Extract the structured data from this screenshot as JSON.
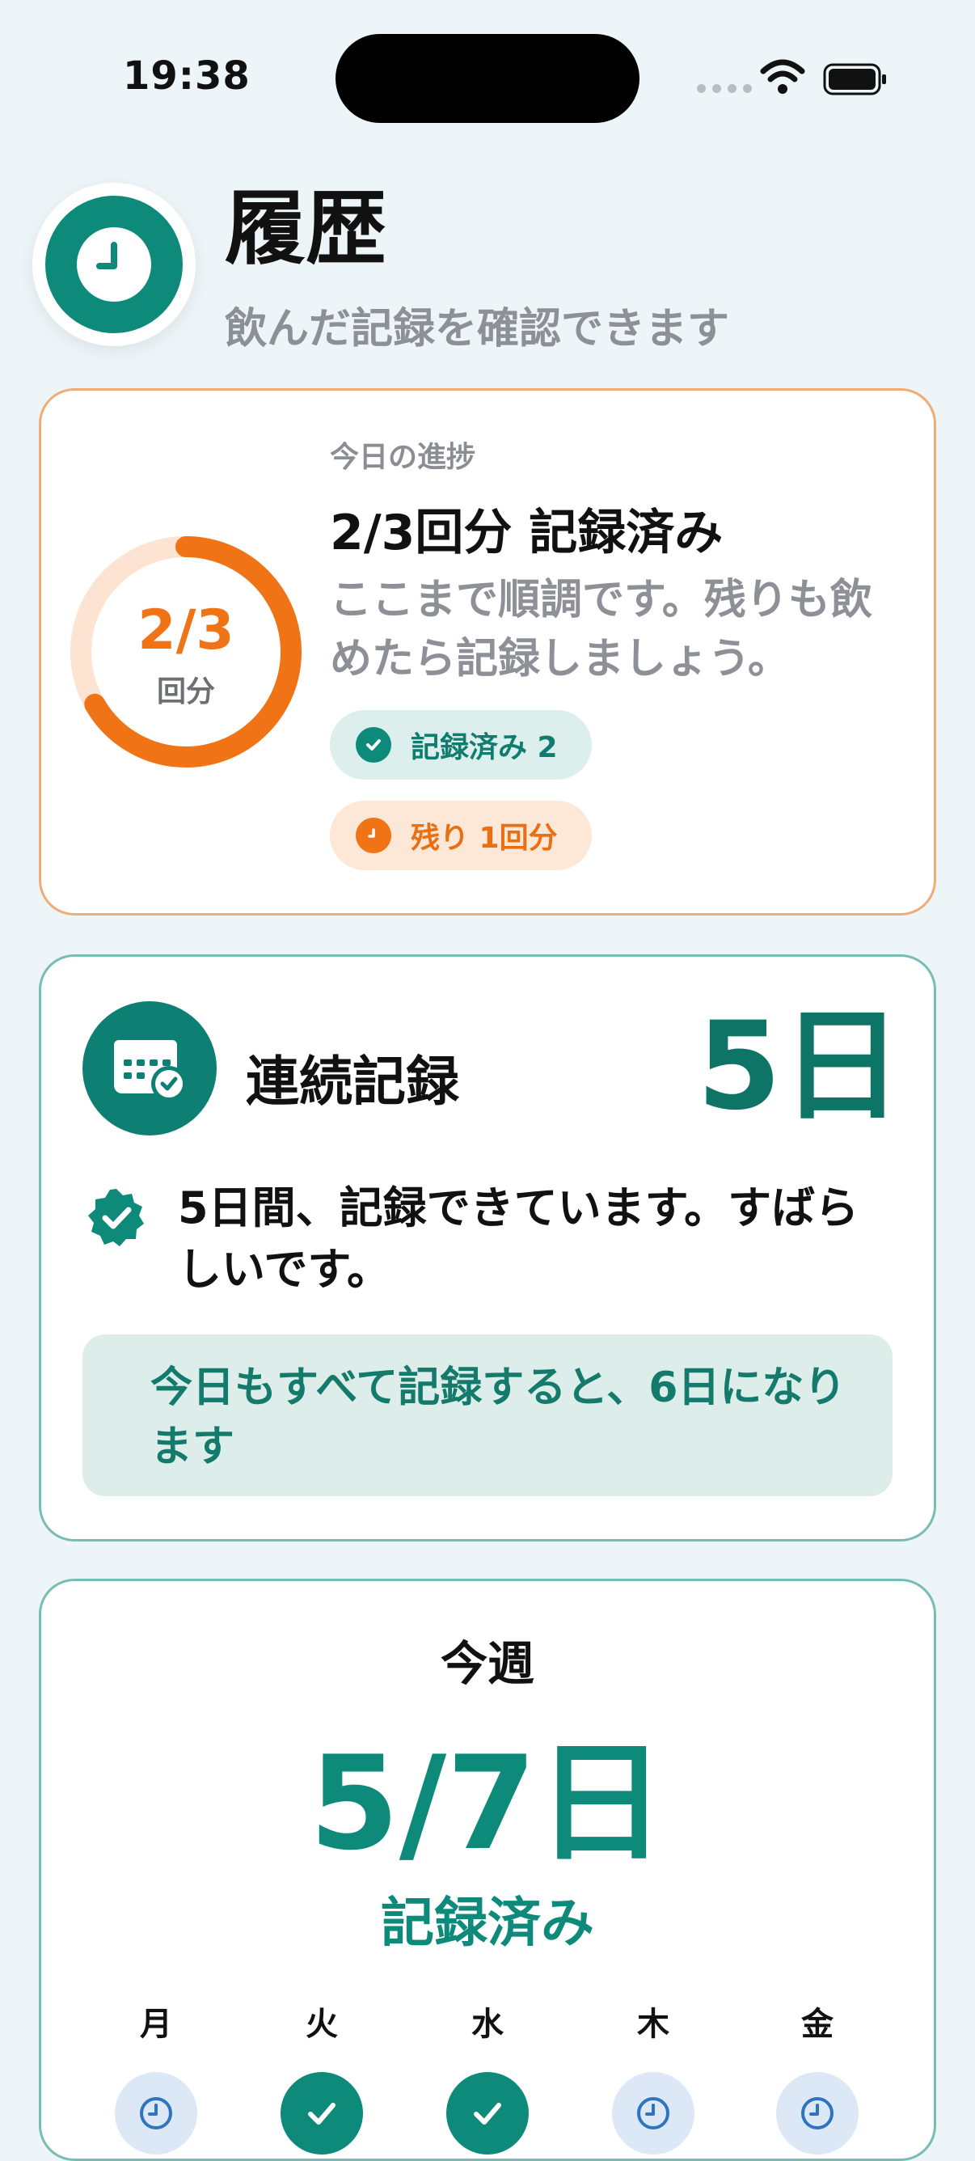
{
  "status_bar": {
    "time": "19:38"
  },
  "header": {
    "title": "履歴",
    "subtitle": "飲んだ記録を確認できます"
  },
  "progress": {
    "label": "今日の進捗",
    "title": "2/3回分 記録済み",
    "message": "ここまで順調です。残りも飲めたら記録しましょう。",
    "ring_value": "2/3",
    "ring_unit": "回分",
    "fraction": 0.6667,
    "done_pill": "記録済み 2",
    "remaining_pill": "残り 1回分"
  },
  "streak": {
    "title": "連続記録",
    "days": "5日",
    "message": "5日間、記録できています。すばらしいです。",
    "hint": "今日もすべて記録すると、6日になります"
  },
  "week": {
    "title": "今週",
    "value": "5/7日",
    "label": "記録済み",
    "days": [
      {
        "name": "月",
        "state": "pending"
      },
      {
        "name": "火",
        "state": "done"
      },
      {
        "name": "水",
        "state": "done"
      },
      {
        "name": "木",
        "state": "pending"
      },
      {
        "name": "金",
        "state": "pending"
      }
    ]
  },
  "colors": {
    "teal": "#0e8a7a",
    "orange": "#f07316",
    "background": "#eef5f9"
  },
  "icons": [
    "clock-icon",
    "calendar-check-icon",
    "verified-badge-icon",
    "check-icon",
    "wifi-icon",
    "battery-icon"
  ]
}
